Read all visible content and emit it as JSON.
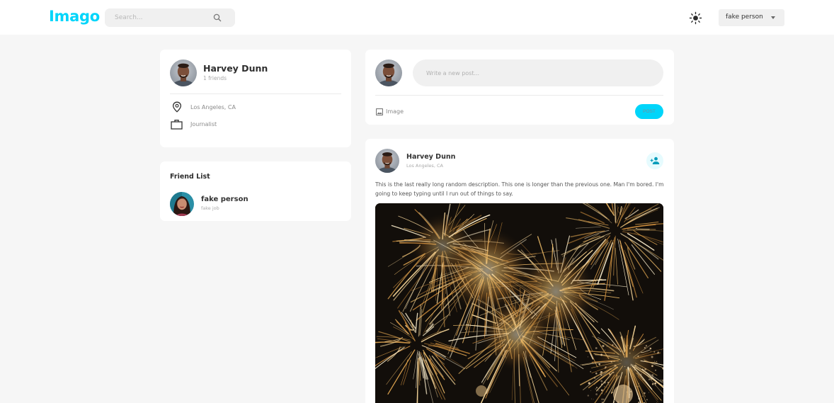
{
  "app": {
    "logo": "Imago",
    "search_placeholder": "Search...",
    "user_select_value": "fake person",
    "accent_color": "#00d5fa"
  },
  "profile": {
    "name": "Harvey Dunn",
    "friends": "1 friends",
    "location": "Los Angeles, CA",
    "occupation": "Journalist"
  },
  "friend_list": {
    "title": "Friend List",
    "friends": [
      {
        "name": "fake person",
        "job": "fake job"
      }
    ]
  },
  "composer": {
    "placeholder": "Write a new post...",
    "image_label": "Image",
    "post_label": "POST"
  },
  "post": {
    "author": "Harvey Dunn",
    "location": "Los Angeles, CA",
    "description": "This is the last really long random description. This one is longer than the previous one. Man I'm bored. I'm going to keep typing until I run out of things to say."
  },
  "icons": {
    "search": "search-icon",
    "theme": "sun-icon",
    "dropdown": "chevron-down-icon",
    "location": "location-pin-icon",
    "work": "briefcase-icon",
    "image": "image-icon",
    "add_friend": "person-add-icon"
  }
}
